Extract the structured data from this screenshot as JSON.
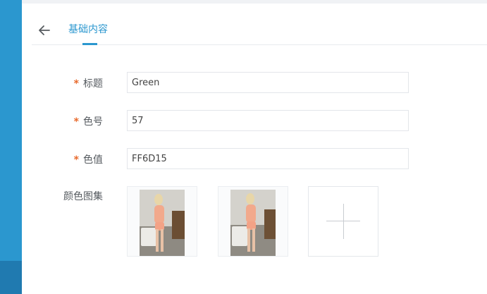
{
  "header": {
    "back_icon": "arrow-left-icon",
    "tab_label": "基础内容"
  },
  "form": {
    "title": {
      "label": "标题",
      "value": "Green",
      "required": true
    },
    "color_number": {
      "label": "色号",
      "value": "57",
      "required": true
    },
    "color_value": {
      "label": "色值",
      "value": "FF6D15",
      "required": true
    },
    "gallery": {
      "label": "颜色图集",
      "add_icon": "plus-icon",
      "image_count": 2
    }
  },
  "required_mark": "*",
  "colors": {
    "accent": "#2b97cf",
    "sidebar": "#2b97cf",
    "required": "#e8692b"
  }
}
